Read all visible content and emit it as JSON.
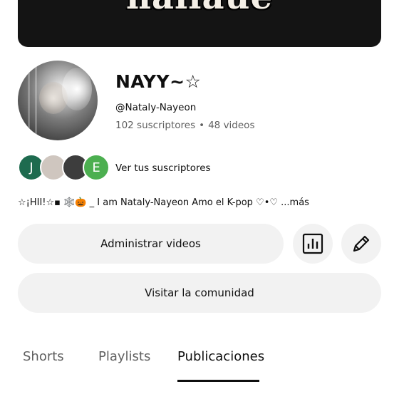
{
  "banner": {
    "text": "naiiaue"
  },
  "channel": {
    "name": "NAYY~☆",
    "handle": "@Nataly-Nayeon",
    "subscribers": "102 suscriptores",
    "separator": "•",
    "videos": "48 videos"
  },
  "subscribers_preview": {
    "avatars": [
      {
        "letter": "J",
        "color": "#1e6b4f"
      },
      {
        "letter": "",
        "color": "#cfc6bf"
      },
      {
        "letter": "",
        "color": "#3d3d3d"
      },
      {
        "letter": "E",
        "color": "#4caf50"
      }
    ],
    "link_label": "Ver tus suscriptores"
  },
  "bio": {
    "text": "☆¡HII!☆▪ 🕸️🎃 _ I am Nataly-Nayeon  Amo el K-pop ♡•♡ ",
    "more": "...más"
  },
  "actions": {
    "manage_videos": "Administrar videos",
    "analytics_icon": "bar-chart-icon",
    "edit_icon": "pencil-icon",
    "visit_community": "Visitar la comunidad"
  },
  "tabs": [
    {
      "label": "Shorts",
      "active": false
    },
    {
      "label": "Playlists",
      "active": false
    },
    {
      "label": "Publicaciones",
      "active": true
    }
  ]
}
